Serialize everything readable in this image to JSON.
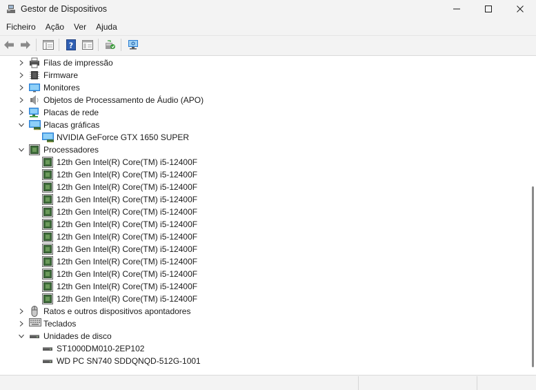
{
  "window": {
    "title": "Gestor de Dispositivos",
    "controls": [
      "minimize",
      "maximize",
      "close"
    ]
  },
  "menu": [
    "Ficheiro",
    "Ação",
    "Ver",
    "Ajuda"
  ],
  "toolbar": {
    "buttons": [
      "back-arrow-icon",
      "forward-arrow-icon",
      "properties-view-icon",
      "help-icon",
      "show-hide-console-tree-icon",
      "update-driver-icon",
      "scan-hardware-icon"
    ]
  },
  "tree": {
    "nodes": [
      {
        "label": "Filas de impressão",
        "icon": "printer-icon",
        "expanded": false
      },
      {
        "label": "Firmware",
        "icon": "firmware-chip-icon",
        "expanded": false
      },
      {
        "label": "Monitores",
        "icon": "monitor-icon",
        "expanded": false
      },
      {
        "label": "Objetos de Processamento de Áudio (APO)",
        "icon": "speaker-icon",
        "expanded": false
      },
      {
        "label": "Placas de rede",
        "icon": "network-adapter-icon",
        "expanded": false
      },
      {
        "label": "Placas gráficas",
        "icon": "display-adapter-icon",
        "expanded": true,
        "children": [
          {
            "label": "NVIDIA GeForce GTX 1650 SUPER",
            "icon": "display-adapter-icon"
          }
        ]
      },
      {
        "label": "Processadores",
        "icon": "processor-icon",
        "expanded": true,
        "children": [
          {
            "label": "12th Gen Intel(R) Core(TM) i5-12400F",
            "icon": "processor-icon"
          },
          {
            "label": "12th Gen Intel(R) Core(TM) i5-12400F",
            "icon": "processor-icon"
          },
          {
            "label": "12th Gen Intel(R) Core(TM) i5-12400F",
            "icon": "processor-icon"
          },
          {
            "label": "12th Gen Intel(R) Core(TM) i5-12400F",
            "icon": "processor-icon"
          },
          {
            "label": "12th Gen Intel(R) Core(TM) i5-12400F",
            "icon": "processor-icon"
          },
          {
            "label": "12th Gen Intel(R) Core(TM) i5-12400F",
            "icon": "processor-icon"
          },
          {
            "label": "12th Gen Intel(R) Core(TM) i5-12400F",
            "icon": "processor-icon"
          },
          {
            "label": "12th Gen Intel(R) Core(TM) i5-12400F",
            "icon": "processor-icon"
          },
          {
            "label": "12th Gen Intel(R) Core(TM) i5-12400F",
            "icon": "processor-icon"
          },
          {
            "label": "12th Gen Intel(R) Core(TM) i5-12400F",
            "icon": "processor-icon"
          },
          {
            "label": "12th Gen Intel(R) Core(TM) i5-12400F",
            "icon": "processor-icon"
          },
          {
            "label": "12th Gen Intel(R) Core(TM) i5-12400F",
            "icon": "processor-icon"
          }
        ]
      },
      {
        "label": "Ratos e outros dispositivos apontadores",
        "icon": "mouse-icon",
        "expanded": false
      },
      {
        "label": "Teclados",
        "icon": "keyboard-icon",
        "expanded": false
      },
      {
        "label": "Unidades de disco",
        "icon": "disk-drive-icon",
        "expanded": true,
        "children": [
          {
            "label": "ST1000DM010-2EP102",
            "icon": "disk-drive-icon"
          },
          {
            "label": "WD PC SN740 SDDQNQD-512G-1001",
            "icon": "disk-drive-icon"
          }
        ]
      }
    ]
  },
  "colors": {
    "chrome_bg": "#f3f3f3",
    "tree_bg": "#ffffff",
    "text": "#1a1a1a",
    "icon_blue": "#2b7cd3",
    "chip_green": "#3e6b3a"
  }
}
